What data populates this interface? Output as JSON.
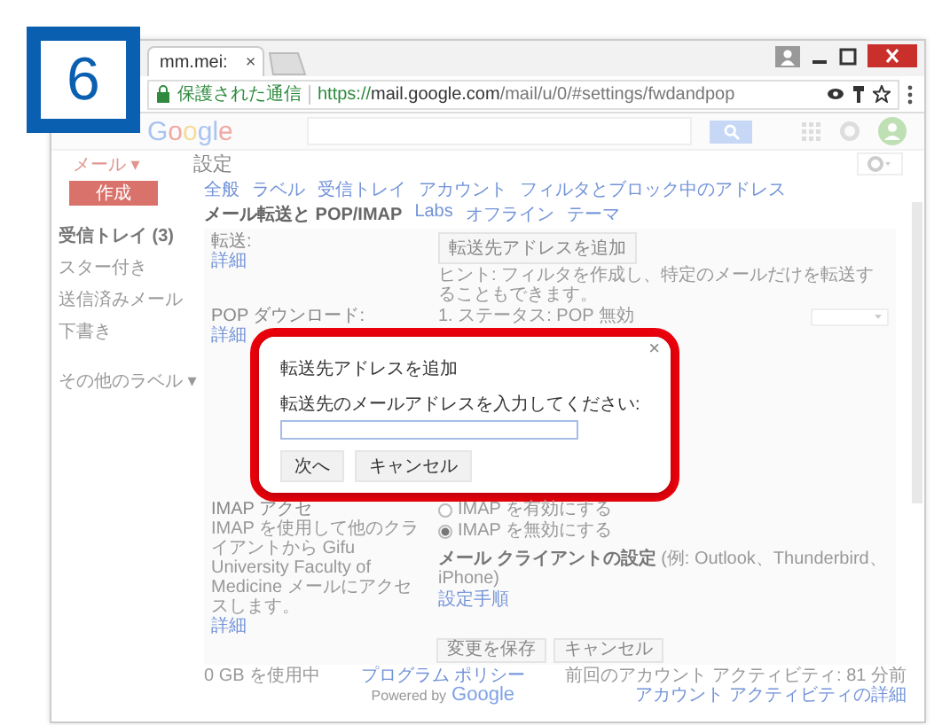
{
  "step_badge": {
    "number": "6"
  },
  "browser": {
    "tab": {
      "title": "mm.mei:",
      "close": "×"
    },
    "security": "保護された通信",
    "url_host": "https://mail.google.com",
    "url_path": "/mail/u/0/#settings/fwdandpop"
  },
  "gmail": {
    "logo": "Google",
    "mail_menu": "メール ▾",
    "page_title": "設定",
    "compose": "作成",
    "sidebar": {
      "items": [
        {
          "label": "受信トレイ (3)",
          "unread": true
        },
        {
          "label": "スター付き",
          "unread": false
        },
        {
          "label": "送信済みメール",
          "unread": false
        },
        {
          "label": "下書き",
          "unread": false
        },
        {
          "label": "その他のラベル ▾",
          "unread": false
        }
      ]
    },
    "settings_tabs": [
      {
        "label": "全般",
        "selected": false
      },
      {
        "label": "ラベル",
        "selected": false
      },
      {
        "label": "受信トレイ",
        "selected": false
      },
      {
        "label": "アカウント",
        "selected": false
      },
      {
        "label": "フィルタとブロック中のアドレス",
        "selected": false
      },
      {
        "label": "メール転送と POP/IMAP",
        "selected": true
      },
      {
        "label": "Labs",
        "selected": false
      },
      {
        "label": "オフライン",
        "selected": false
      },
      {
        "label": "テーマ",
        "selected": false
      }
    ],
    "forwarding": {
      "label": "転送:",
      "link": "詳細",
      "button": "転送先アドレスを追加",
      "hint": "ヒント: フィルタを作成し、特定のメールだけを転送することもできます。"
    },
    "pop": {
      "label": "POP ダウンロード:",
      "link": "詳細",
      "status": "1. ステータス: POP 無効"
    },
    "imap": {
      "label": "IMAP アクセ",
      "description": "IMAP を使用して他のクライアントから Gifu University Faculty of Medicine メールにアクセスします。",
      "link": "詳細",
      "options": [
        {
          "label": "IMAP を有効にする",
          "selected": false
        },
        {
          "label": "IMAP を無効にする",
          "selected": true
        }
      ],
      "client_heading": "メール クライアントの設定",
      "client_examples": "(例: Outlook、Thunderbird、iPhone)",
      "client_link": "設定手順"
    },
    "actions": [
      "変更を保存",
      "キャンセル"
    ],
    "footer": {
      "usage": "0 GB を使用中",
      "policy": "プログラム ポリシー",
      "powered": "Powered by",
      "powered_logo": "Google",
      "activity": "前回のアカウント アクティビティ: 81 分前",
      "activity_link": "アカウント アクティビティの詳細"
    }
  },
  "dialog": {
    "title": "転送先アドレスを追加",
    "close": "×",
    "prompt": "転送先のメールアドレスを入力してください:",
    "buttons": [
      "次へ",
      "キャンセル"
    ]
  }
}
